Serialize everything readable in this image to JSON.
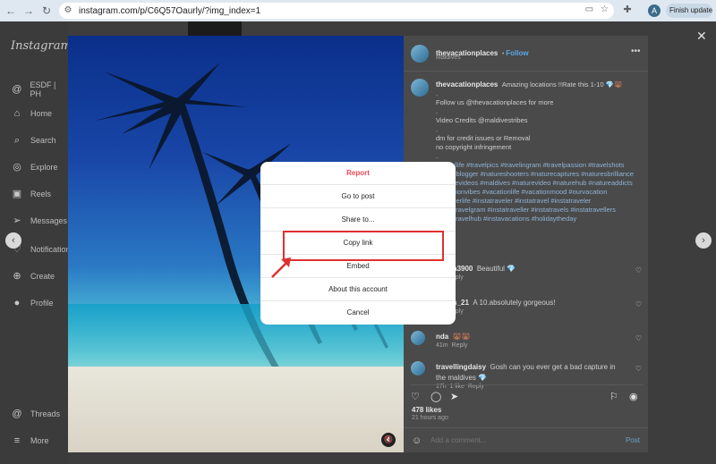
{
  "browser": {
    "url": "instagram.com/p/C6Q57Oaurly/?img_index=1",
    "finish_update_label": "Finish update",
    "profile_initial": "A"
  },
  "sidebar": {
    "logo": "Instagram",
    "items": [
      {
        "label": "ESDF | PH",
        "icon": "threads-logo-icon"
      },
      {
        "label": "Home",
        "icon": "home-icon"
      },
      {
        "label": "Search",
        "icon": "search-icon"
      },
      {
        "label": "Explore",
        "icon": "compass-icon"
      },
      {
        "label": "Reels",
        "icon": "reels-icon"
      },
      {
        "label": "Messages",
        "icon": "messenger-icon"
      },
      {
        "label": "Notifications",
        "icon": "heart-icon"
      },
      {
        "label": "Create",
        "icon": "plus-icon"
      },
      {
        "label": "Profile",
        "icon": "avatar-icon"
      },
      {
        "label": "Threads",
        "icon": "threads-icon"
      },
      {
        "label": "More",
        "icon": "menu-icon"
      }
    ]
  },
  "post": {
    "username": "thevacationplaces",
    "follow_label": "Follow",
    "location": "Maldives",
    "caption": {
      "text": "Amazing locations !!Rate this 1-10 💎🐻",
      "dot1": ".",
      "dot2": ".",
      "follow_line": "Follow us @thevacationplaces for more",
      "dot3": ".",
      "dot4": ".",
      "credits": "Video Credits @maldivestribes",
      "dm_line": "dm for credit issues or Removal",
      "copyright": "no copyright infringement",
      "dot5": ".",
      "dot6": ".",
      "hashtags": "#travellife #travelpics #travelingram #travelpassion #travelshots #travelblogger #natureshooters #naturecaptures #naturesbrilliance #naturevideos #maldives #naturevideo #naturehub #natureaddicts #vacationvibes #vacationlife #vacationmood #ourvacation #travelerlife #instatraveler #instatravel #instatraveler #instatravelgram #instatraveller #instatravels #instatravellers #instatravelhub #instavacations #holidaytheday"
    },
    "comments": [
      {
        "user": "garcia3900",
        "text": "Beautiful 💎",
        "time": "1w",
        "likes": "",
        "reply": "Reply"
      },
      {
        "user": "_stars_21",
        "text": "A 10.absolutely gorgeous!",
        "time": "1w",
        "likes": "",
        "reply": "Reply"
      },
      {
        "user": "nda",
        "text": "🐻🐻",
        "time": "41m",
        "likes": "",
        "reply": "Reply"
      },
      {
        "user": "travellingdaisy",
        "text": "Gosh can you ever get a bad capture in the maldives 💎",
        "time": "17h",
        "likes": "1 like",
        "reply": "Reply"
      }
    ],
    "likes": "478 likes",
    "time_ago": "21 hours ago",
    "add_comment_placeholder": "Add a comment...",
    "post_label": "Post"
  },
  "modal": {
    "items": [
      "Report",
      "Go to post",
      "Share to...",
      "Copy link",
      "Embed",
      "About this account",
      "Cancel"
    ]
  },
  "colors": {
    "report_red": "#ed4956",
    "highlight_red": "#e03030",
    "follow_blue": "#5aa9e6"
  }
}
